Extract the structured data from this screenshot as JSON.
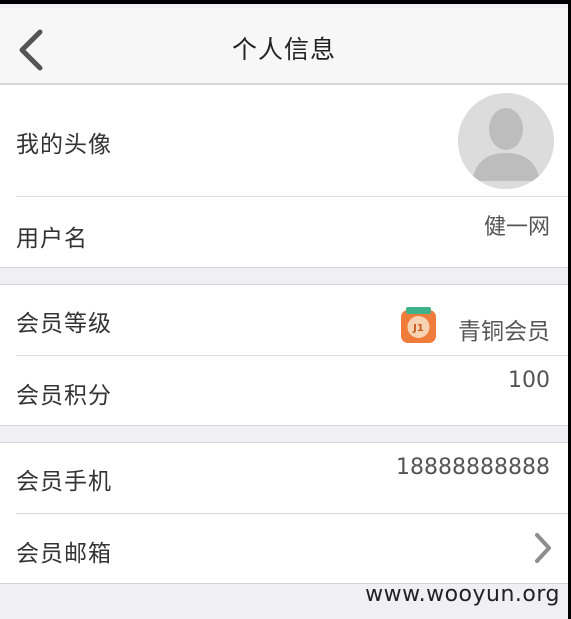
{
  "header": {
    "title": "个人信息",
    "back_icon": "chevron-left-icon"
  },
  "profile": {
    "avatar_label": "我的头像",
    "username_label": "用户名",
    "username_value": "健一网"
  },
  "membership": {
    "level_label": "会员等级",
    "level_value": "青铜会员",
    "level_badge_text": "J1",
    "points_label": "会员积分",
    "points_value": "100"
  },
  "contact": {
    "phone_label": "会员手机",
    "phone_value": "18888888888",
    "email_label": "会员邮箱"
  },
  "watermark": "www.wooyun.org",
  "colors": {
    "background": "#efeff4",
    "badge_orange": "#f07c3b",
    "badge_green": "#3fb28a",
    "chevron": "#8e8e8e"
  }
}
